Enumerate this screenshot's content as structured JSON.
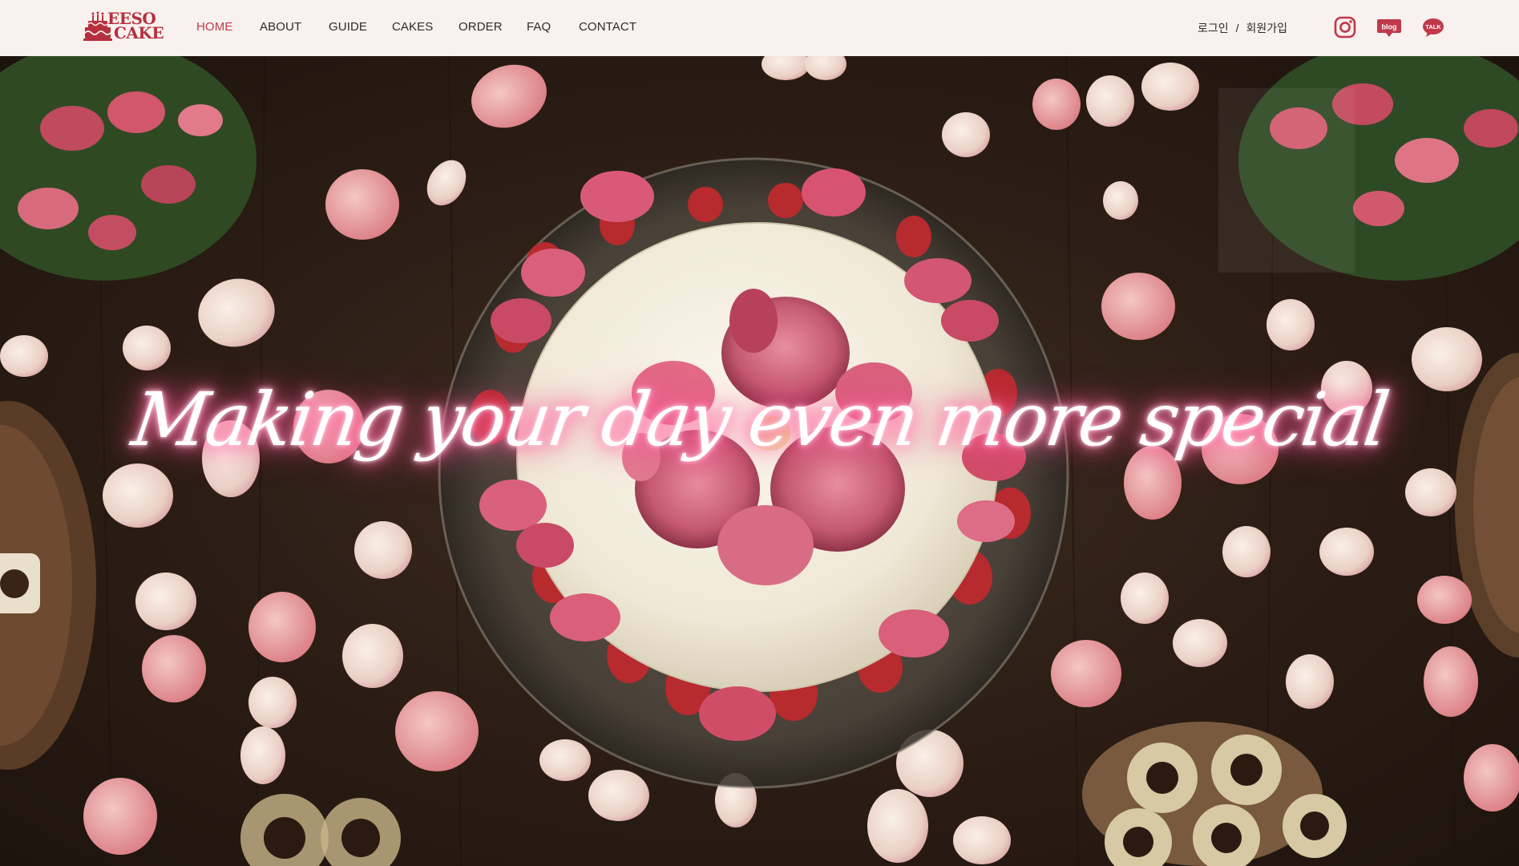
{
  "brand": {
    "logo_line1": "EESO",
    "logo_line2": "CAKE",
    "accent": "#b5303e"
  },
  "nav": {
    "items": [
      {
        "label": "HOME",
        "active": true
      },
      {
        "label": "ABOUT",
        "active": false
      },
      {
        "label": "GUIDE",
        "active": false
      },
      {
        "label": "CAKES",
        "active": false
      },
      {
        "label": "ORDER",
        "active": false
      },
      {
        "label": "FAQ",
        "active": false
      },
      {
        "label": "CONTACT",
        "active": false
      }
    ]
  },
  "auth": {
    "login": "로그인",
    "separator": "/",
    "signup": "회원가입"
  },
  "social": [
    {
      "icon": "instagram-icon",
      "label": ""
    },
    {
      "icon": "blog-icon",
      "label": "blog"
    },
    {
      "icon": "kakaotalk-icon",
      "label": "TALK"
    }
  ],
  "hero": {
    "title": "Making your day even more special",
    "glow_color": "#ff5c9a"
  }
}
